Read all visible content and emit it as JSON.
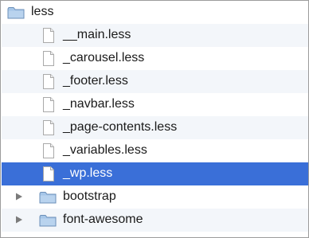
{
  "tree": {
    "root": {
      "label": "less",
      "icon": "folder-icon",
      "expanded": true
    },
    "files": [
      {
        "label": "__main.less",
        "icon": "document-icon"
      },
      {
        "label": "_carousel.less",
        "icon": "document-icon"
      },
      {
        "label": "_footer.less",
        "icon": "document-icon"
      },
      {
        "label": "_navbar.less",
        "icon": "document-icon"
      },
      {
        "label": "_page-contents.less",
        "icon": "document-icon"
      },
      {
        "label": "_variables.less",
        "icon": "document-icon"
      },
      {
        "label": "_wp.less",
        "icon": "document-icon",
        "selected": true
      }
    ],
    "folders": [
      {
        "label": "bootstrap",
        "icon": "folder-icon",
        "expanded": false
      },
      {
        "label": "font-awesome",
        "icon": "folder-icon",
        "expanded": false
      }
    ]
  },
  "colors": {
    "selection": "#3a6fd8",
    "alternate_row": "#f3f6fa",
    "folder": "#9fc1e6"
  }
}
